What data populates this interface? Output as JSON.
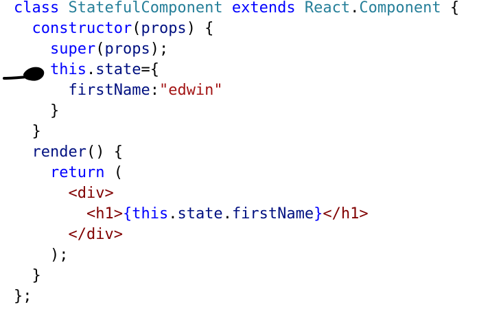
{
  "colors": {
    "keyword": "#0000ff",
    "dark_blue": "#001080",
    "type": "#267f99",
    "function": "#001080",
    "string": "#a31515",
    "tag": "#800000",
    "text": "#000000"
  },
  "annotation": {
    "icon": "hand-drawn-arrow-icon",
    "color": "#000000"
  },
  "code": {
    "lines": [
      {
        "tokens": [
          {
            "t": "class",
            "c": "keyword"
          },
          {
            "t": " ",
            "c": "text"
          },
          {
            "t": "StatefulComponent",
            "c": "type"
          },
          {
            "t": " ",
            "c": "text"
          },
          {
            "t": "extends",
            "c": "keyword"
          },
          {
            "t": " ",
            "c": "text"
          },
          {
            "t": "React",
            "c": "type"
          },
          {
            "t": ".",
            "c": "text"
          },
          {
            "t": "Component",
            "c": "type"
          },
          {
            "t": " {",
            "c": "text"
          }
        ]
      },
      {
        "tokens": [
          {
            "t": "  ",
            "c": "text"
          },
          {
            "t": "constructor",
            "c": "keyword"
          },
          {
            "t": "(",
            "c": "text"
          },
          {
            "t": "props",
            "c": "dark_blue"
          },
          {
            "t": ") {",
            "c": "text"
          }
        ]
      },
      {
        "tokens": [
          {
            "t": "    ",
            "c": "text"
          },
          {
            "t": "super",
            "c": "keyword"
          },
          {
            "t": "(",
            "c": "text"
          },
          {
            "t": "props",
            "c": "dark_blue"
          },
          {
            "t": ");",
            "c": "text"
          }
        ]
      },
      {
        "tokens": [
          {
            "t": "    ",
            "c": "text"
          },
          {
            "t": "this",
            "c": "keyword"
          },
          {
            "t": ".",
            "c": "text"
          },
          {
            "t": "state",
            "c": "dark_blue"
          },
          {
            "t": "={",
            "c": "text"
          }
        ]
      },
      {
        "tokens": [
          {
            "t": "      ",
            "c": "text"
          },
          {
            "t": "firstName",
            "c": "dark_blue"
          },
          {
            "t": ":",
            "c": "text"
          },
          {
            "t": "\"edwin\"",
            "c": "string"
          }
        ]
      },
      {
        "tokens": [
          {
            "t": "    }",
            "c": "text"
          }
        ]
      },
      {
        "tokens": [
          {
            "t": "  }",
            "c": "text"
          }
        ]
      },
      {
        "tokens": [
          {
            "t": "  ",
            "c": "text"
          },
          {
            "t": "render",
            "c": "dark_blue"
          },
          {
            "t": "() {",
            "c": "text"
          }
        ]
      },
      {
        "tokens": [
          {
            "t": "    ",
            "c": "text"
          },
          {
            "t": "return",
            "c": "keyword"
          },
          {
            "t": " (",
            "c": "text"
          }
        ]
      },
      {
        "tokens": [
          {
            "t": "      ",
            "c": "text"
          },
          {
            "t": "<",
            "c": "tag"
          },
          {
            "t": "div",
            "c": "tag"
          },
          {
            "t": ">",
            "c": "tag"
          }
        ]
      },
      {
        "tokens": [
          {
            "t": "        ",
            "c": "text"
          },
          {
            "t": "<",
            "c": "tag"
          },
          {
            "t": "h1",
            "c": "tag"
          },
          {
            "t": ">",
            "c": "tag"
          },
          {
            "t": "{",
            "c": "keyword"
          },
          {
            "t": "this",
            "c": "keyword"
          },
          {
            "t": ".",
            "c": "text"
          },
          {
            "t": "state",
            "c": "dark_blue"
          },
          {
            "t": ".",
            "c": "text"
          },
          {
            "t": "firstName",
            "c": "dark_blue"
          },
          {
            "t": "}",
            "c": "keyword"
          },
          {
            "t": "</",
            "c": "tag"
          },
          {
            "t": "h1",
            "c": "tag"
          },
          {
            "t": ">",
            "c": "tag"
          }
        ]
      },
      {
        "tokens": [
          {
            "t": "      ",
            "c": "text"
          },
          {
            "t": "</",
            "c": "tag"
          },
          {
            "t": "div",
            "c": "tag"
          },
          {
            "t": ">",
            "c": "tag"
          }
        ]
      },
      {
        "tokens": [
          {
            "t": "    );",
            "c": "text"
          }
        ]
      },
      {
        "tokens": [
          {
            "t": "  }",
            "c": "text"
          }
        ]
      },
      {
        "tokens": [
          {
            "t": "};",
            "c": "text"
          }
        ]
      }
    ]
  }
}
